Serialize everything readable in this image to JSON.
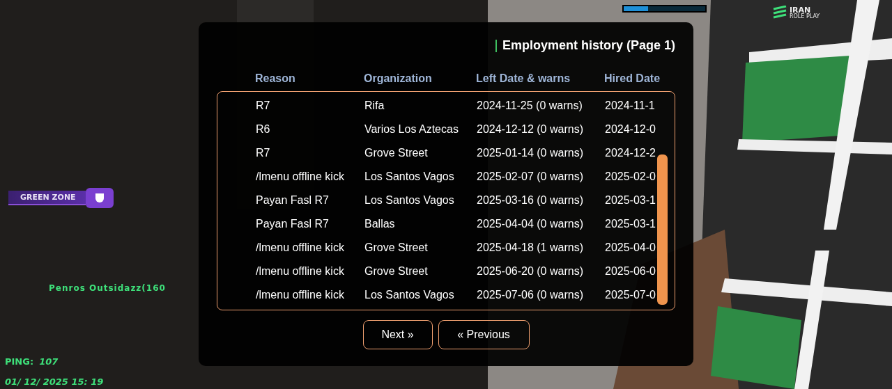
{
  "hud": {
    "health_bar": {
      "level": 0.3
    },
    "logo": {
      "line1": "IRAN",
      "line2": "ROLE PLAY"
    },
    "zone": "GREEN ZONE",
    "player_label": "Penros Outsidazz(160",
    "ping_label": "PING:",
    "ping": "107",
    "datetime": "01/ 12/ 2025 15: 19"
  },
  "dialog": {
    "title": "Employment history (Page 1)",
    "columns": [
      "Reason",
      "Organization",
      "Left Date & warns",
      "Hired Date"
    ],
    "rows": [
      [
        "R7",
        "Rifa",
        "2024-11-25 (0 warns)",
        "2024-11-1"
      ],
      [
        "R6",
        "Varios Los Aztecas",
        "2024-12-12 (0 warns)",
        "2024-12-0"
      ],
      [
        "R7",
        "Grove Street",
        "2025-01-14 (0 warns)",
        "2024-12-2"
      ],
      [
        "/lmenu offline kick",
        "Los Santos Vagos",
        "2025-02-07 (0 warns)",
        "2025-02-0"
      ],
      [
        "Payan Fasl R7",
        "Los Santos Vagos",
        "2025-03-16 (0 warns)",
        "2025-03-1"
      ],
      [
        "Payan Fasl R7",
        "Ballas",
        "2025-04-04 (0 warns)",
        "2025-03-1"
      ],
      [
        "/lmenu offline kick",
        "Grove Street",
        "2025-04-18 (1 warns)",
        "2025-04-0"
      ],
      [
        "/lmenu offline kick",
        "Grove Street",
        "2025-06-20 (0 warns)",
        "2025-06-0"
      ],
      [
        "/lmenu offline kick",
        "Los Santos Vagos",
        "2025-07-06 (0 warns)",
        "2025-07-0"
      ]
    ],
    "buttons": [
      "Next »",
      "« Previous"
    ]
  }
}
